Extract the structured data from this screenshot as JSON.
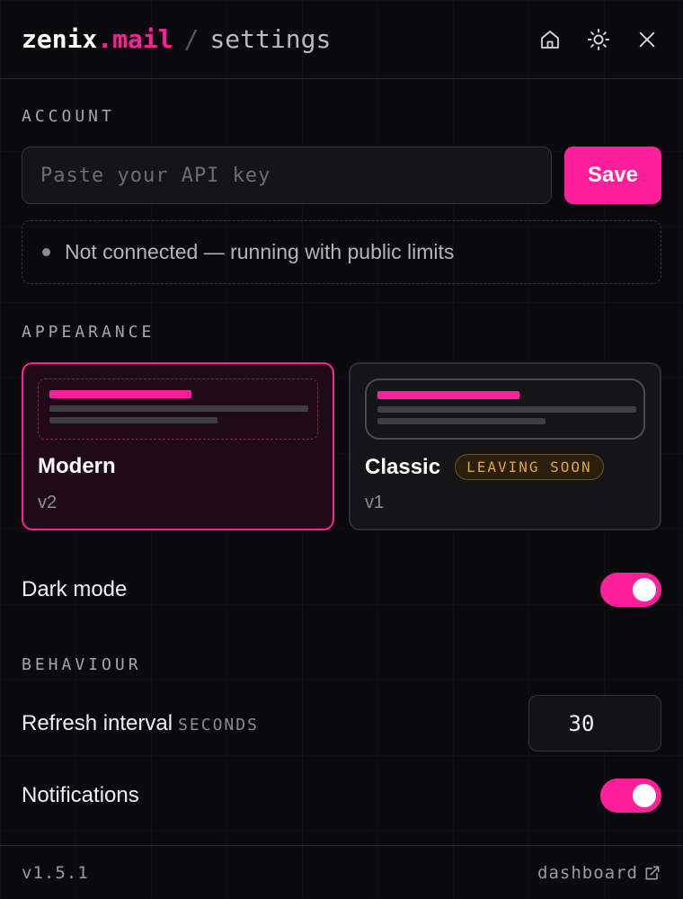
{
  "header": {
    "brand_name": "zenix",
    "brand_tld": ".mail",
    "separator": "/",
    "page": "settings",
    "icons": [
      "home-icon",
      "sun-icon",
      "close-icon"
    ]
  },
  "account": {
    "label": "ACCOUNT",
    "api_placeholder": "Paste your API key",
    "api_value": "",
    "save_label": "Save",
    "status": "Not connected — running with public limits"
  },
  "appearance": {
    "label": "APPEARANCE",
    "themes": [
      {
        "name": "Modern",
        "version": "v2",
        "selected": true
      },
      {
        "name": "Classic",
        "version": "v1",
        "badge": "LEAVING SOON",
        "selected": false
      }
    ],
    "dark_mode_label": "Dark mode",
    "dark_mode_on": true
  },
  "behaviour": {
    "label": "BEHAVIOUR",
    "refresh_label": "Refresh interval",
    "refresh_unit": "SECONDS",
    "refresh_value": "30",
    "notifications_label": "Notifications",
    "notifications_on": true
  },
  "footer": {
    "version": "v1.5.1",
    "dashboard_link": "dashboard"
  },
  "colors": {
    "accent": "#ff1f9b",
    "background": "#0a0a0c",
    "badge": "#e6a23c"
  }
}
